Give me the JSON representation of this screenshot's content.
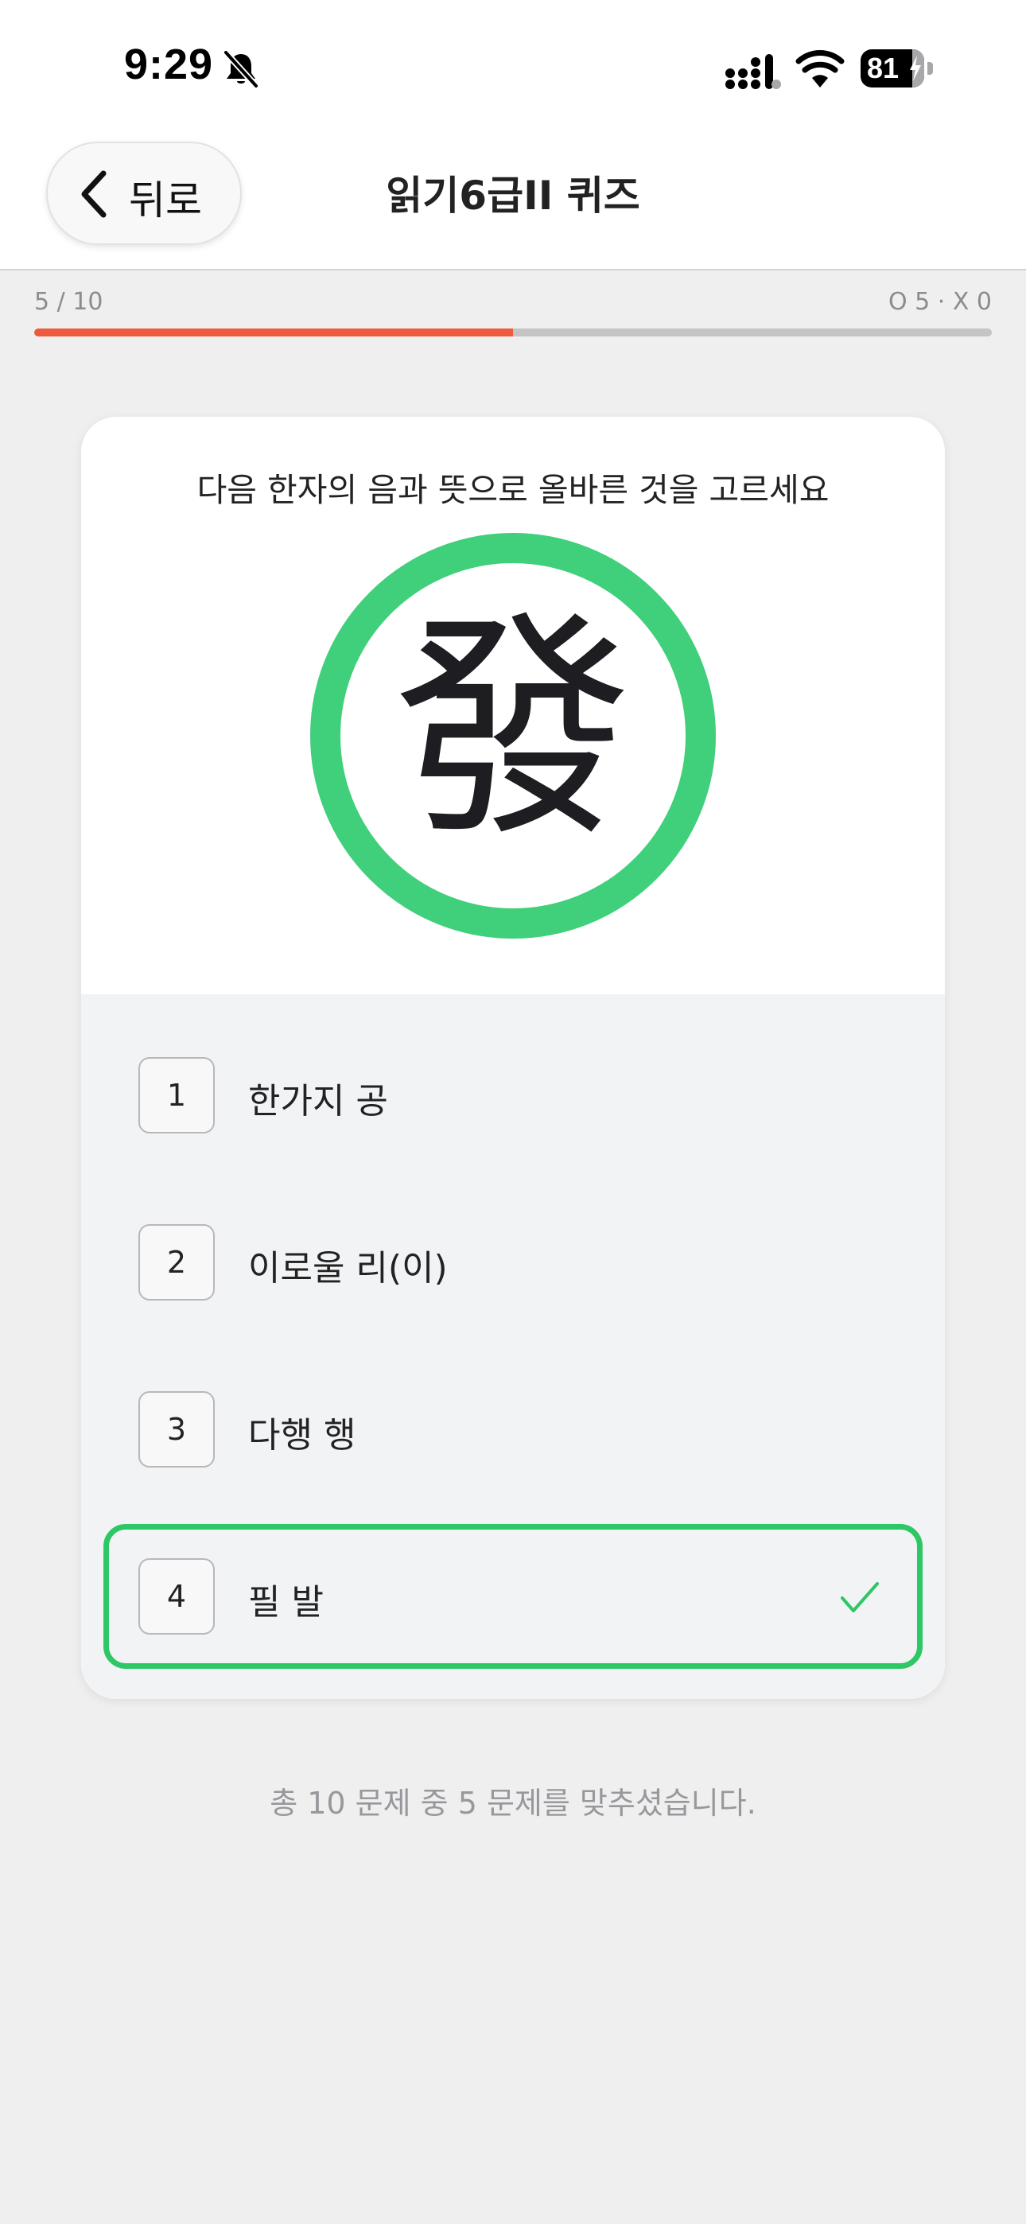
{
  "status_bar": {
    "time": "9:29",
    "battery_percent": "81",
    "battery_level": 0.81,
    "icons": [
      "bell-slash-icon",
      "signal-icon",
      "wifi-icon",
      "battery-icon"
    ]
  },
  "header": {
    "back_label": "뒤로",
    "title": "읽기6급II 퀴즈"
  },
  "progress": {
    "count_text": "5 / 10",
    "score_text": "O 5 · X 0",
    "fraction": 0.5,
    "colors": {
      "fill": "#ee5a3c",
      "track": "#c4c4c6"
    }
  },
  "quiz": {
    "question": "다음 한자의 음과 뜻으로 올바른 것을 고르세요",
    "hanja": "發",
    "correct_color": "#40cf7a",
    "options": [
      {
        "number": "1",
        "label": "한가지 공"
      },
      {
        "number": "2",
        "label": "이로울 리(이)"
      },
      {
        "number": "3",
        "label": "다행 행"
      },
      {
        "number": "4",
        "label": "필 발",
        "selected": true,
        "icon": "check-icon"
      }
    ]
  },
  "result": {
    "text": "총 10 문제 중 5 문제를 맞추셨습니다."
  }
}
